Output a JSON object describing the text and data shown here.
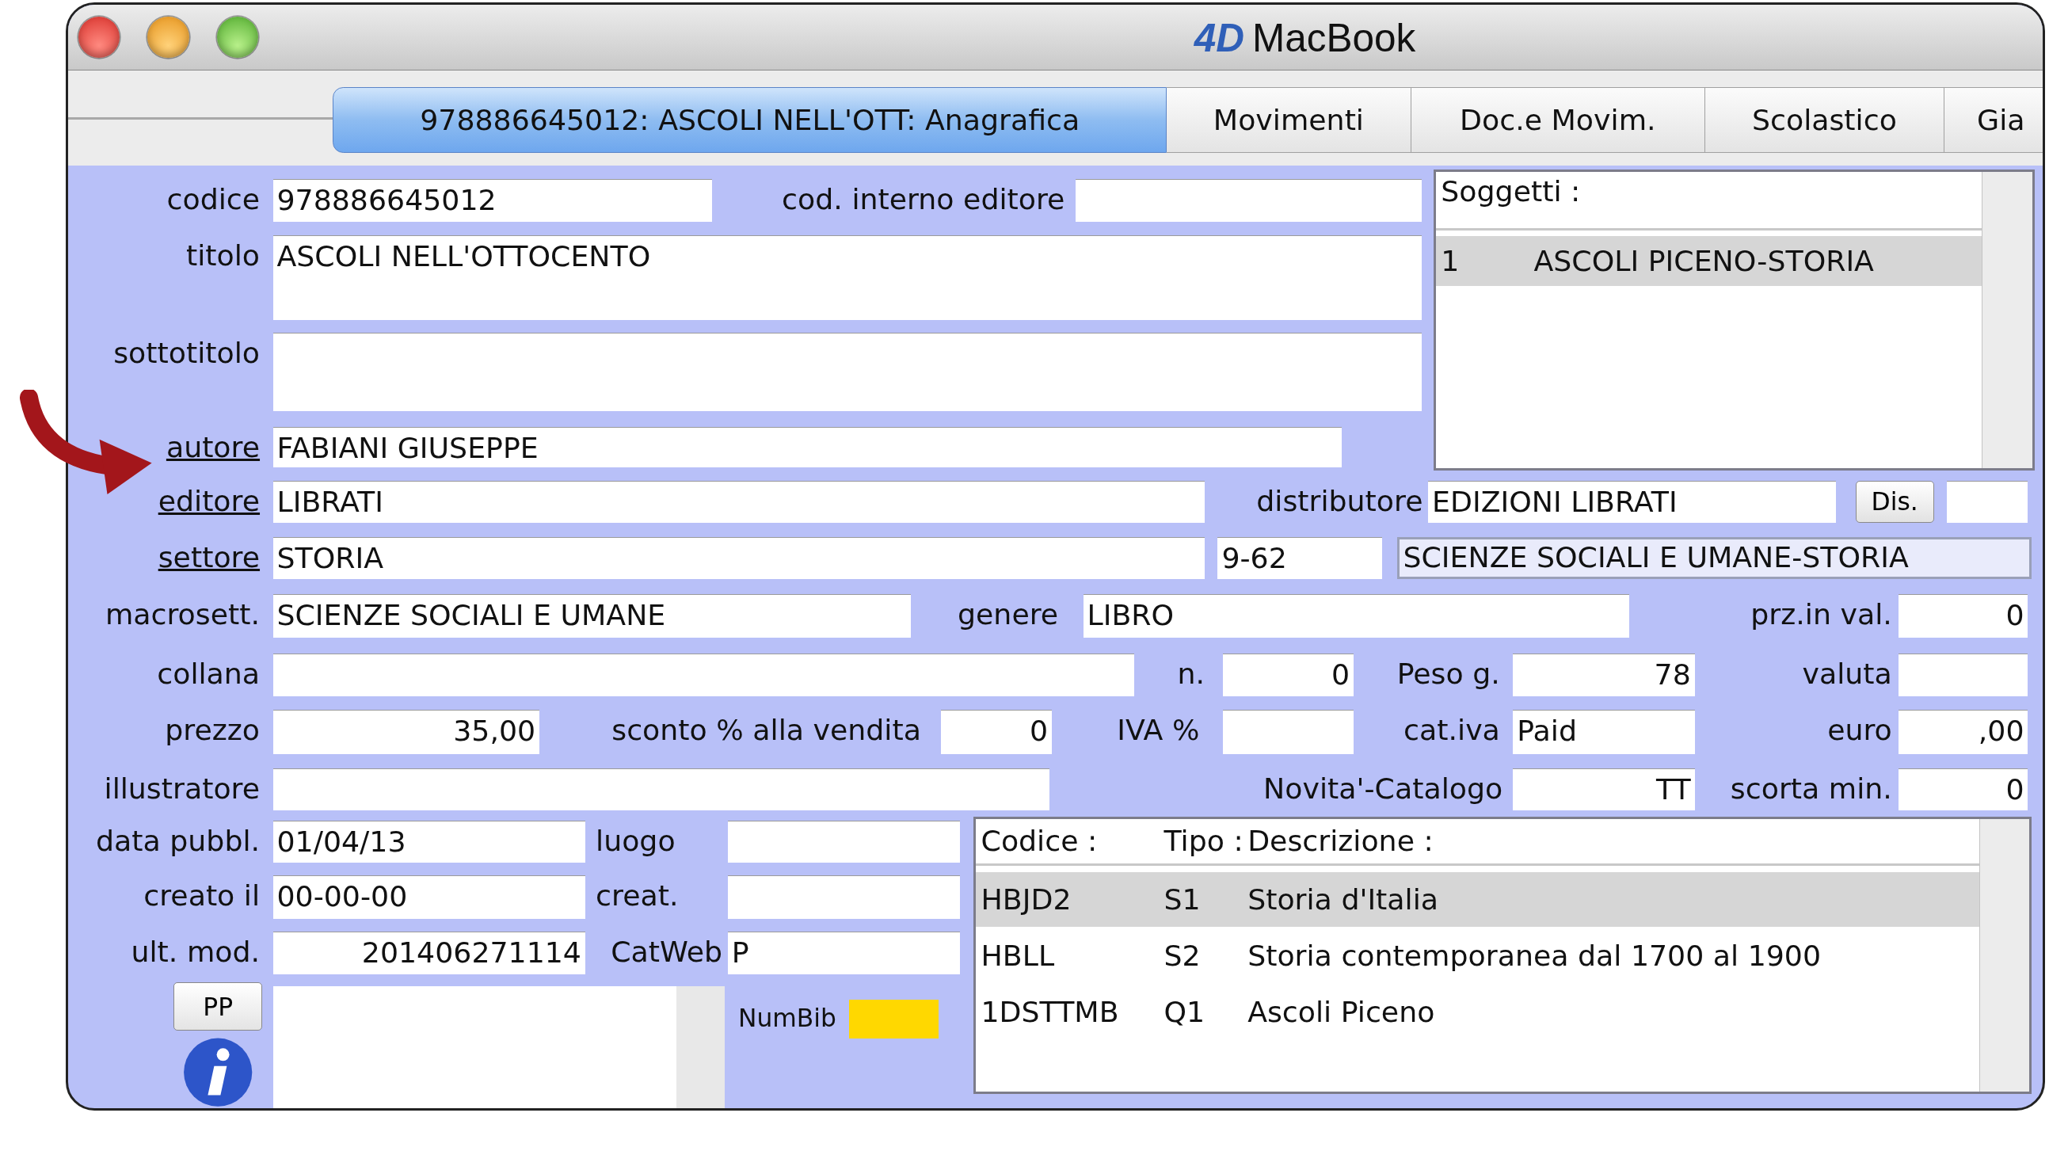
{
  "window": {
    "logo": "4D",
    "title": "MacBook"
  },
  "tabs": [
    {
      "label": "978886645012: ASCOLI NELL'OTT: Anagrafica",
      "selected": true
    },
    {
      "label": "Movimenti",
      "selected": false
    },
    {
      "label": "Doc.e Movim.",
      "selected": false
    },
    {
      "label": "Scolastico",
      "selected": false
    },
    {
      "label": "Gia",
      "selected": false
    }
  ],
  "form_rows": [
    {
      "items": [
        {
          "kind": "label",
          "text": "codice"
        },
        {
          "kind": "field",
          "value": "978886645012"
        },
        {
          "kind": "label",
          "text": "cod. interno editore"
        },
        {
          "kind": "field"
        }
      ]
    },
    {
      "items": [
        {
          "kind": "label",
          "text": "titolo"
        },
        {
          "kind": "field",
          "value": "ASCOLI NELL'OTTOCENTO"
        }
      ]
    },
    {
      "items": [
        {
          "kind": "label",
          "text": "sottotitolo"
        },
        {
          "kind": "field"
        }
      ]
    },
    {
      "items": [
        {
          "kind": "link",
          "text": "autore"
        },
        {
          "kind": "field",
          "value": "FABIANI GIUSEPPE"
        }
      ]
    },
    {
      "items": [
        {
          "kind": "link",
          "text": "editore"
        },
        {
          "kind": "field",
          "value": "LIBRATI"
        },
        {
          "kind": "label",
          "text": "distributore"
        },
        {
          "kind": "field",
          "value": "EDIZIONI LIBRATI"
        },
        {
          "kind": "button",
          "text": "Dis."
        },
        {
          "kind": "field"
        }
      ]
    },
    {
      "items": [
        {
          "kind": "link",
          "text": "settore"
        },
        {
          "kind": "field",
          "value": "STORIA"
        },
        {
          "kind": "field",
          "value": "9-62"
        },
        {
          "kind": "field",
          "value": "SCIENZE SOCIALI E UMANE-STORIA"
        }
      ]
    },
    {
      "items": [
        {
          "kind": "label",
          "text": "macrosett."
        },
        {
          "kind": "field",
          "value": "SCIENZE SOCIALI E UMANE"
        },
        {
          "kind": "label",
          "text": "genere"
        },
        {
          "kind": "field",
          "value": "LIBRO"
        },
        {
          "kind": "label",
          "text": "prz.in val."
        },
        {
          "kind": "field",
          "value": "0"
        }
      ]
    },
    {
      "items": [
        {
          "kind": "label",
          "text": "collana"
        },
        {
          "kind": "field"
        },
        {
          "kind": "label",
          "text": "n."
        },
        {
          "kind": "field",
          "value": "0"
        },
        {
          "kind": "label",
          "text": "Peso g."
        },
        {
          "kind": "field",
          "value": "78"
        },
        {
          "kind": "label",
          "text": "valuta"
        },
        {
          "kind": "field"
        }
      ]
    },
    {
      "items": [
        {
          "kind": "label",
          "text": "prezzo"
        },
        {
          "kind": "field",
          "value": "35,00"
        },
        {
          "kind": "label",
          "text": "sconto % alla vendita"
        },
        {
          "kind": "field",
          "value": "0"
        },
        {
          "kind": "label",
          "text": "IVA %"
        },
        {
          "kind": "field"
        },
        {
          "kind": "label",
          "text": "cat.iva"
        },
        {
          "kind": "field",
          "value": "Paid"
        },
        {
          "kind": "label",
          "text": "euro"
        },
        {
          "kind": "field",
          "value": ",00"
        }
      ]
    },
    {
      "items": [
        {
          "kind": "label",
          "text": "illustratore"
        },
        {
          "kind": "field"
        },
        {
          "kind": "label",
          "text": "Novita'-Catalogo"
        },
        {
          "kind": "field",
          "value": "TT"
        },
        {
          "kind": "label",
          "text": "scorta min."
        },
        {
          "kind": "field",
          "value": "0"
        }
      ]
    },
    {
      "items": [
        {
          "kind": "label",
          "text": "data pubbl."
        },
        {
          "kind": "field",
          "value": "01/04/13"
        },
        {
          "kind": "label",
          "text": "luogo"
        },
        {
          "kind": "field"
        }
      ]
    },
    {
      "items": [
        {
          "kind": "label",
          "text": "creato il"
        },
        {
          "kind": "field",
          "value": "00-00-00"
        },
        {
          "kind": "label",
          "text": "creat."
        },
        {
          "kind": "field"
        }
      ]
    },
    {
      "items": [
        {
          "kind": "label",
          "text": "ult. mod."
        },
        {
          "kind": "field",
          "value": "201406271114"
        },
        {
          "kind": "label",
          "text": "CatWeb"
        },
        {
          "kind": "field",
          "value": "P"
        }
      ]
    }
  ],
  "soggetti": {
    "title": "Soggetti :",
    "rows": [
      {
        "number": "1",
        "name": "ASCOLI PICENO-STORIA",
        "selected": true
      }
    ]
  },
  "classifications": {
    "columns": [
      "Codice :",
      "Tipo :",
      "Descrizione :"
    ],
    "rows": [
      {
        "code": "HBJD2",
        "type": "S1",
        "description": "Storia d'Italia",
        "selected": true
      },
      {
        "code": "HBLL",
        "type": "S2",
        "description": "Storia contemporanea dal 1700 al 1900",
        "selected": false
      },
      {
        "code": "1DSTTMB",
        "type": "Q1",
        "description": "Ascoli Piceno",
        "selected": false
      }
    ]
  },
  "pp_button": "PP",
  "numbib_label": "NumBib"
}
